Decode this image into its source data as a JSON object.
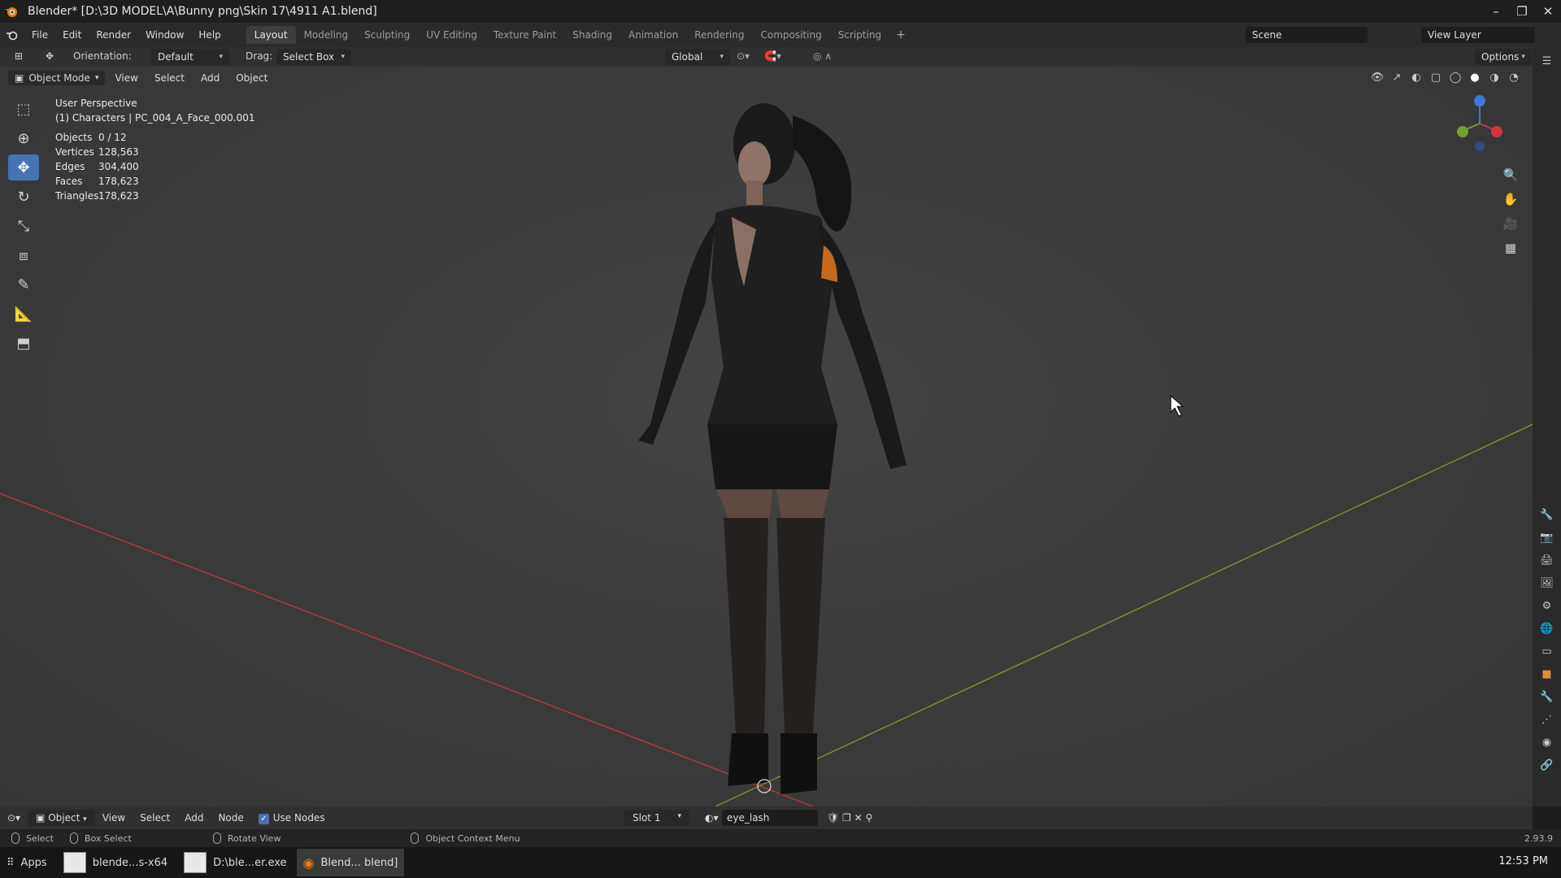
{
  "window": {
    "title": "Blender* [D:\\3D MODEL\\A\\Bunny png\\Skin 17\\4911 A1.blend]",
    "controls": [
      "–",
      "❐",
      "✕"
    ]
  },
  "menu": [
    "File",
    "Edit",
    "Render",
    "Window",
    "Help"
  ],
  "workspaces": [
    {
      "label": "Layout",
      "active": true
    },
    {
      "label": "Modeling"
    },
    {
      "label": "Sculpting"
    },
    {
      "label": "UV Editing"
    },
    {
      "label": "Texture Paint"
    },
    {
      "label": "Shading"
    },
    {
      "label": "Animation"
    },
    {
      "label": "Rendering"
    },
    {
      "label": "Compositing"
    },
    {
      "label": "Scripting"
    }
  ],
  "scene": {
    "name": "Scene",
    "view_layer": "View Layer"
  },
  "tool_header": {
    "orientation_label": "Orientation:",
    "orientation_value": "Default",
    "drag_label": "Drag:",
    "drag_value": "Select Box",
    "transform_orientation": "Global",
    "options": "Options"
  },
  "viewport_header": {
    "mode": "Object Mode",
    "menus": [
      "View",
      "Select",
      "Add",
      "Object"
    ]
  },
  "viewport_info": {
    "perspective": "User Perspective",
    "collection": "(1) Characters | PC_004_A_Face_000.001"
  },
  "stats": [
    {
      "k": "Objects",
      "v": "0 / 12"
    },
    {
      "k": "Vertices",
      "v": "128,563"
    },
    {
      "k": "Edges",
      "v": "304,400"
    },
    {
      "k": "Faces",
      "v": "178,623"
    },
    {
      "k": "Triangles",
      "v": "178,623"
    }
  ],
  "node_header": {
    "editor_type": "Object",
    "menus": [
      "View",
      "Select",
      "Add",
      "Node"
    ],
    "use_nodes": "Use Nodes",
    "slot": "Slot 1",
    "material": "eye_lash"
  },
  "statusbar": {
    "select": "Select",
    "box_select": "Box Select",
    "rotate_view": "Rotate View",
    "context_menu": "Object Context Menu",
    "version": "2.93.9"
  },
  "taskbar": {
    "apps": "Apps",
    "items": [
      {
        "label": "blende...s-x64"
      },
      {
        "label": "D:\\ble...er.exe"
      },
      {
        "label": "Blend... blend]",
        "active": true
      }
    ],
    "clock": "12:53 PM"
  }
}
